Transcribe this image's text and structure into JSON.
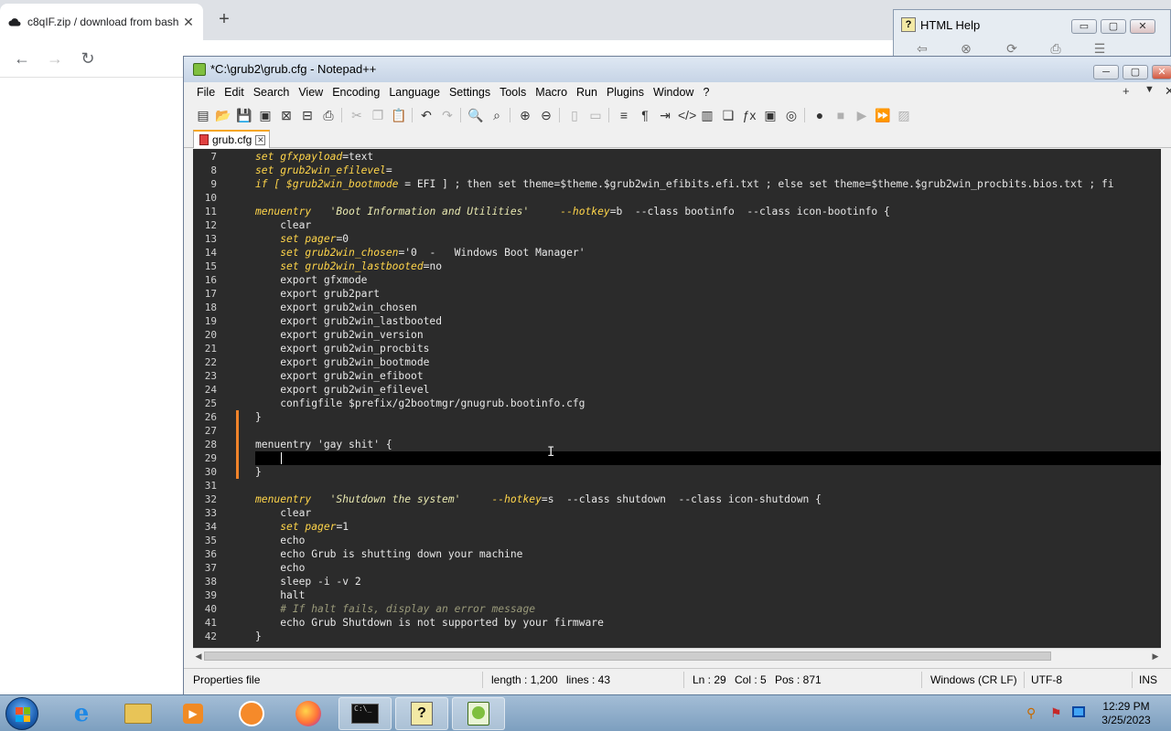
{
  "browser": {
    "tab_title": "c8qIF.zip / download from bash",
    "tab_close": "✕",
    "new_tab": "+",
    "back": "←",
    "forward": "→",
    "reload": "↻"
  },
  "help_window": {
    "title": "HTML Help",
    "minimize": "▭",
    "maximize": "▢",
    "close": "✕"
  },
  "npp": {
    "title": "*C:\\grub2\\grub.cfg - Notepad++",
    "window_buttons": {
      "minimize": "─",
      "maximize": "▢",
      "close": "✕"
    },
    "menu": [
      "File",
      "Edit",
      "Search",
      "View",
      "Encoding",
      "Language",
      "Settings",
      "Tools",
      "Macro",
      "Run",
      "Plugins",
      "Window",
      "?"
    ],
    "menu_right": {
      "plus": "+",
      "dropdown": "▼",
      "close": "✕"
    },
    "tab": {
      "label": "grub.cfg",
      "close": "✕"
    },
    "status": {
      "language": "Properties file",
      "length": "length : 1,200",
      "lines": "lines : 43",
      "ln": "Ln : 29",
      "col": "Col : 5",
      "pos": "Pos : 871",
      "eol": "Windows (CR LF)",
      "encoding": "UTF-8",
      "mode": "INS"
    }
  },
  "editor": {
    "current_line": 29,
    "changed_lines": [
      26,
      27,
      28,
      29,
      30
    ],
    "lines": [
      {
        "n": "7",
        "segs": [
          [
            "kw",
            "set gfxpayload"
          ],
          [
            "",
            "=text"
          ]
        ]
      },
      {
        "n": "8",
        "segs": [
          [
            "kw",
            "set grub2win_efilevel"
          ],
          [
            "",
            "="
          ]
        ]
      },
      {
        "n": "9",
        "segs": [
          [
            "kw",
            "if [ $grub2win_bootmode"
          ],
          [
            "",
            " = EFI ] ; then set theme=$theme.$grub2win_efibits.efi.txt ; else set theme=$theme.$grub2win_procbits.bios.txt ; fi"
          ]
        ]
      },
      {
        "n": "10",
        "segs": []
      },
      {
        "n": "11",
        "segs": [
          [
            "kw",
            "menuentry"
          ],
          [
            "",
            "   "
          ],
          [
            "str",
            "'Boot Information and Utilities'"
          ],
          [
            "",
            "     "
          ],
          [
            "kw",
            "--hotkey"
          ],
          [
            "",
            "=b  --class bootinfo  --class icon-bootinfo {"
          ]
        ]
      },
      {
        "n": "12",
        "segs": [
          [
            "",
            "    clear"
          ]
        ]
      },
      {
        "n": "13",
        "segs": [
          [
            "",
            "    "
          ],
          [
            "kw",
            "set pager"
          ],
          [
            "",
            "=0"
          ]
        ]
      },
      {
        "n": "14",
        "segs": [
          [
            "",
            "    "
          ],
          [
            "kw",
            "set grub2win_chosen"
          ],
          [
            "",
            "='0  -   Windows Boot Manager'"
          ]
        ]
      },
      {
        "n": "15",
        "segs": [
          [
            "",
            "    "
          ],
          [
            "kw",
            "set grub2win_lastbooted"
          ],
          [
            "",
            "=no"
          ]
        ]
      },
      {
        "n": "16",
        "segs": [
          [
            "",
            "    export gfxmode"
          ]
        ]
      },
      {
        "n": "17",
        "segs": [
          [
            "",
            "    export grub2part"
          ]
        ]
      },
      {
        "n": "18",
        "segs": [
          [
            "",
            "    export grub2win_chosen"
          ]
        ]
      },
      {
        "n": "19",
        "segs": [
          [
            "",
            "    export grub2win_lastbooted"
          ]
        ]
      },
      {
        "n": "20",
        "segs": [
          [
            "",
            "    export grub2win_version"
          ]
        ]
      },
      {
        "n": "21",
        "segs": [
          [
            "",
            "    export grub2win_procbits"
          ]
        ]
      },
      {
        "n": "22",
        "segs": [
          [
            "",
            "    export grub2win_bootmode"
          ]
        ]
      },
      {
        "n": "23",
        "segs": [
          [
            "",
            "    export grub2win_efiboot"
          ]
        ]
      },
      {
        "n": "24",
        "segs": [
          [
            "",
            "    export grub2win_efilevel"
          ]
        ]
      },
      {
        "n": "25",
        "segs": [
          [
            "",
            "    configfile $prefix/g2bootmgr/gnugrub.bootinfo.cfg"
          ]
        ]
      },
      {
        "n": "26",
        "segs": [
          [
            "",
            "}"
          ]
        ]
      },
      {
        "n": "27",
        "segs": []
      },
      {
        "n": "28",
        "segs": [
          [
            "",
            "menuentry 'gay shit' {"
          ]
        ]
      },
      {
        "n": "29",
        "segs": [
          [
            "",
            "    "
          ]
        ]
      },
      {
        "n": "30",
        "segs": [
          [
            "",
            "}"
          ]
        ]
      },
      {
        "n": "31",
        "segs": []
      },
      {
        "n": "32",
        "segs": [
          [
            "kw",
            "menuentry"
          ],
          [
            "",
            "   "
          ],
          [
            "str",
            "'Shutdown the system'"
          ],
          [
            "",
            "     "
          ],
          [
            "kw",
            "--hotkey"
          ],
          [
            "",
            "=s  --class shutdown  --class icon-shutdown {"
          ]
        ]
      },
      {
        "n": "33",
        "segs": [
          [
            "",
            "    clear"
          ]
        ]
      },
      {
        "n": "34",
        "segs": [
          [
            "",
            "    "
          ],
          [
            "kw",
            "set pager"
          ],
          [
            "",
            "=1"
          ]
        ]
      },
      {
        "n": "35",
        "segs": [
          [
            "",
            "    echo"
          ]
        ]
      },
      {
        "n": "36",
        "segs": [
          [
            "",
            "    echo Grub is shutting down your machine"
          ]
        ]
      },
      {
        "n": "37",
        "segs": [
          [
            "",
            "    echo"
          ]
        ]
      },
      {
        "n": "38",
        "segs": [
          [
            "",
            "    sleep -i -v 2"
          ]
        ]
      },
      {
        "n": "39",
        "segs": [
          [
            "",
            "    halt"
          ]
        ]
      },
      {
        "n": "40",
        "segs": [
          [
            "",
            "    "
          ],
          [
            "cm",
            "# If halt fails, display an error message"
          ]
        ]
      },
      {
        "n": "41",
        "segs": [
          [
            "",
            "    echo Grub Shutdown is not supported by your firmware"
          ]
        ]
      },
      {
        "n": "42",
        "segs": [
          [
            "",
            "}"
          ]
        ]
      }
    ]
  },
  "taskbar": {
    "time": "12:29 PM",
    "date": "3/25/2023"
  },
  "colors": {
    "editor_bg": "#2b2b2b",
    "keyword": "#ffd54a",
    "change_marker": "#f0832a",
    "tab_accent": "#f5a623"
  }
}
